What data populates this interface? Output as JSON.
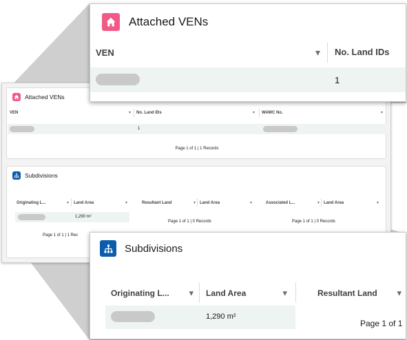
{
  "attached": {
    "title": "Attached VENs",
    "col_ven": "VEN",
    "col_land_ids": "No. Land IDs",
    "col_wawc": "WAWC No.",
    "row_land_ids": "1",
    "footer": "Page 1 of 1 | 1 Records"
  },
  "subdivisions": {
    "title": "Subdivisions",
    "col_originating": "Originating L...",
    "col_land_area": "Land Area",
    "col_resultant": "Resultant Land",
    "col_associated": "Associated L...",
    "row_land_area": "1,290 m²",
    "footer_originating": "Page 1 of 1 | 1 Rec",
    "footer_resultant": "Page 1 of 1 | 0 Records",
    "footer_associated": "Page 1 of 1 | 0 Records",
    "zoom_footer": "Page 1 of 1"
  },
  "icons": {
    "chevron": "▾",
    "home": "home-icon",
    "hierarchy": "hierarchy-icon"
  },
  "colors": {
    "home_icon": "#f15a86",
    "hierarchy_icon": "#0b5cab",
    "selected_row": "#eef4f1"
  }
}
